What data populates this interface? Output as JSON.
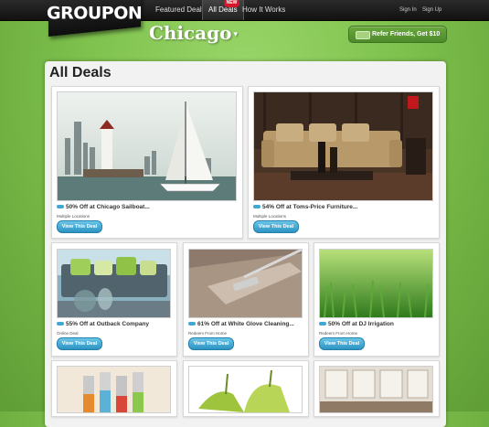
{
  "logo": {
    "text": "GROUPON"
  },
  "nav": {
    "featured": "Featured Deal",
    "all_deals": "All Deals",
    "new_badge": "NEW",
    "how_it_works": "How It Works",
    "sign_in": "Sign In",
    "sign_up": "Sign Up"
  },
  "city": {
    "name": "Chicago",
    "arrow": "▾"
  },
  "refer": {
    "label": "Refer Friends, Get $10"
  },
  "main": {
    "title": "All Deals"
  },
  "deals": [
    {
      "title": "50% Off at Chicago Sailboat...",
      "sub": "Multiple Locations",
      "button": "View This Deal"
    },
    {
      "title": "54% Off at Toms-Price Furniture...",
      "sub": "Multiple Locations",
      "button": "View This Deal"
    },
    {
      "title": "55% Off at Outback Company",
      "sub": "Online Deal",
      "button": "View This Deal"
    },
    {
      "title": "61% Off at White Glove Cleaning...",
      "sub": "Redeem From Home",
      "button": "View This Deal"
    },
    {
      "title": "50% Off at DJ Irrigation",
      "sub": "Redeem From Home",
      "button": "View This Deal"
    }
  ],
  "colors": {
    "background_green": "#7fc24e",
    "button_blue": "#2c93c2",
    "badge_red": "#d8152a",
    "topbar": "#1a1a1a"
  }
}
